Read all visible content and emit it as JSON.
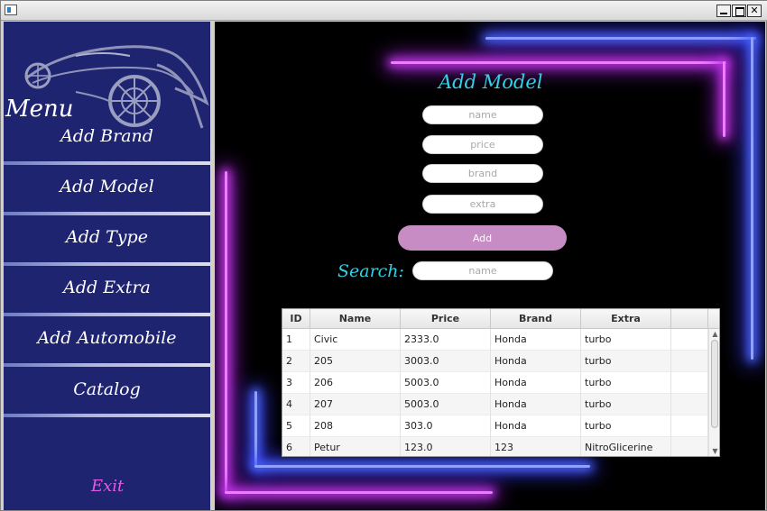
{
  "window": {
    "minimize_icon": "minimize-icon",
    "maximize_icon": "maximize-icon",
    "close_icon": "close-icon",
    "close_glyph": "✕"
  },
  "sidebar": {
    "menu_title": "Menu",
    "items": [
      {
        "label": "Add Brand"
      },
      {
        "label": "Add Model"
      },
      {
        "label": "Add Type"
      },
      {
        "label": "Add Extra"
      },
      {
        "label": "Add Automobile"
      },
      {
        "label": "Catalog"
      }
    ],
    "exit_label": "Exit",
    "colors": {
      "background": "#1f2470",
      "exit": "#e15be6"
    }
  },
  "form": {
    "title": "Add Model",
    "name_placeholder": "name",
    "price_placeholder": "price",
    "brand_placeholder": "brand",
    "extra_placeholder": "extra",
    "add_label": "Add",
    "search_label": "Search:",
    "search_placeholder": "name",
    "colors": {
      "accent": "#2fd2e6",
      "button": "#c78cc3"
    }
  },
  "table": {
    "columns": [
      "ID",
      "Name",
      "Price",
      "Brand",
      "Extra",
      ""
    ],
    "rows": [
      [
        "1",
        "Civic",
        "2333.0",
        "Honda",
        "turbo"
      ],
      [
        "2",
        "205",
        "3003.0",
        "Honda",
        "turbo"
      ],
      [
        "3",
        "206",
        "5003.0",
        "Honda",
        "turbo"
      ],
      [
        "4",
        "207",
        "5003.0",
        "Honda",
        "turbo"
      ],
      [
        "5",
        "208",
        "303.0",
        "Honda",
        "turbo"
      ],
      [
        "6",
        "Petur",
        "123.0",
        "123",
        "NitroGlicerine"
      ]
    ]
  }
}
